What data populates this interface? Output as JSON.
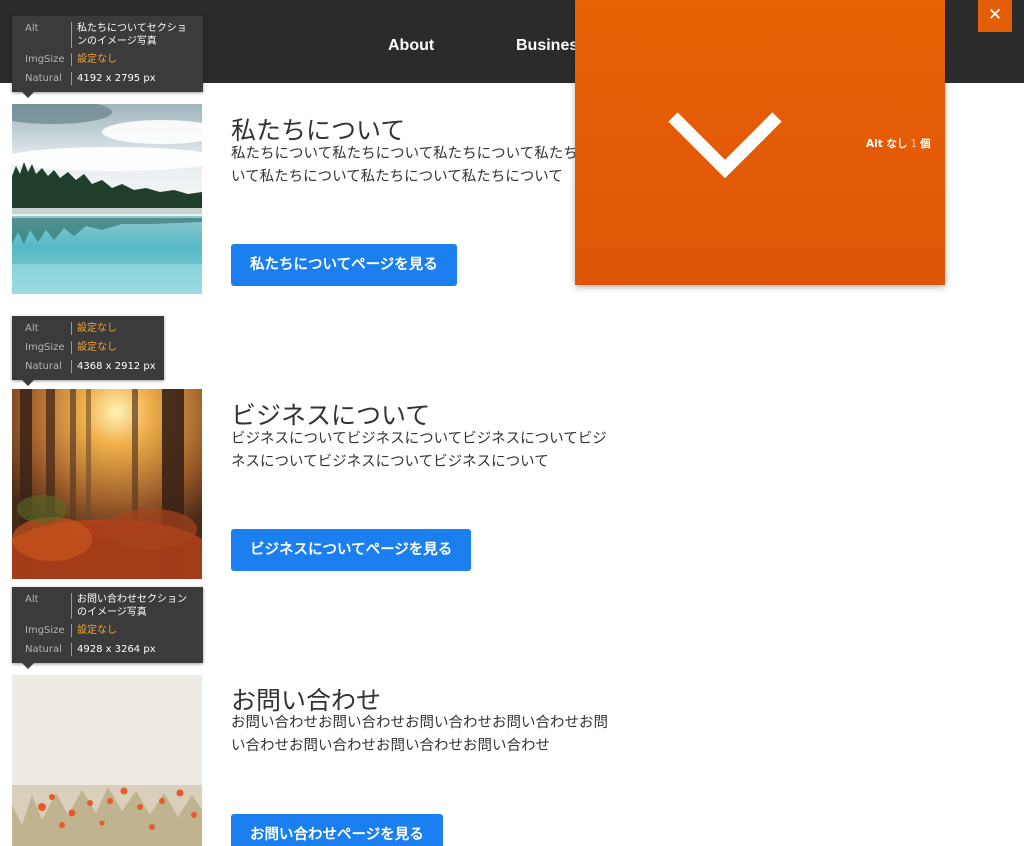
{
  "nav": {
    "items": [
      {
        "label": "About"
      },
      {
        "label": "Business"
      }
    ]
  },
  "sections": [
    {
      "title": "私たちについて",
      "text": "私たちについて私たちについて私たちについて私たちについて私たちについて私たちについて私たちについて",
      "button": "私たちについてページを見る",
      "image_info": {
        "alt_label": "Alt",
        "alt_value": "私たちについてセクションのイメージ写真",
        "imgsize_label": "ImgSize",
        "imgsize_value": "設定なし",
        "natural_label": "Natural",
        "natural_value": "4192 x 2795 px"
      }
    },
    {
      "title": "ビジネスについて",
      "text": "ビジネスについてビジネスについてビジネスについてビジネスについてビジネスについてビジネスについて",
      "button": "ビジネスについてページを見る",
      "image_info": {
        "alt_label": "Alt",
        "alt_value": "設定なし",
        "imgsize_label": "ImgSize",
        "imgsize_value": "設定なし",
        "natural_label": "Natural",
        "natural_value": "4368 x 2912 px"
      }
    },
    {
      "title": "お問い合わせ",
      "text": "お問い合わせお問い合わせお問い合わせお問い合わせお問い合わせお問い合わせお問い合わせお問い合わせ",
      "button": "お問い合わせページを見る",
      "image_info": {
        "alt_label": "Alt",
        "alt_value": "お問い合わせセクションのイメージ写真",
        "imgsize_label": "ImgSize",
        "imgsize_value": "設定なし",
        "natural_label": "Natural",
        "natural_value": "4928 x 3264 px"
      }
    }
  ],
  "alt_checker": {
    "prefix": "Alt なし",
    "count": "1",
    "suffix": "個",
    "toggle_icon": "chevron-down-icon",
    "close_label": "✕",
    "close_icon": "close-icon",
    "panel_color": "#e35e08"
  },
  "colors": {
    "button": "#1b7ff0",
    "nav_bg": "#2b2b2b",
    "warning_text": "#f2a32c"
  }
}
